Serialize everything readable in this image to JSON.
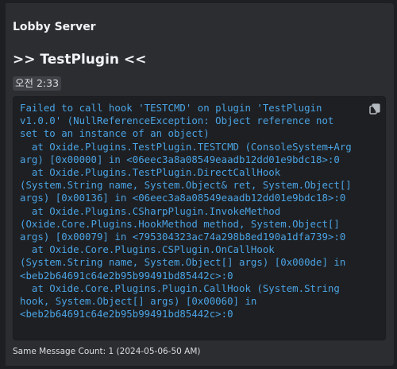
{
  "message": {
    "author": "Lobby Server",
    "title": ">> TestPlugin <<",
    "timestamp": "오전 2:33",
    "code_lines": [
      "Failed to call hook 'TESTCMD' on plugin 'TestPlugin",
      "v1.0.0' (NullReferenceException: Object reference not",
      "set to an instance of an object)",
      "  at Oxide.Plugins.TestPlugin.TESTCMD (ConsoleSystem+Arg",
      "arg) [0x00000] in <06eec3a8a08549eaadb12dd01e9bdc18>:0",
      "  at Oxide.Plugins.TestPlugin.DirectCallHook",
      "(System.String name, System.Object& ret, System.Object[]",
      "args) [0x00136] in <06eec3a8a08549eaadb12dd01e9bdc18>:0",
      "  at Oxide.Plugins.CSharpPlugin.InvokeMethod",
      "(Oxide.Core.Plugins.HookMethod method, System.Object[]",
      "args) [0x00079] in <795304323ac74a298b8ed190a1dfa739>:0",
      "  at Oxide.Core.Plugins.CSPlugin.OnCallHook",
      "(System.String name, System.Object[] args) [0x000de] in",
      "<beb2b64691c64e2b95b99491bd85442c>:0",
      "  at Oxide.Core.Plugins.Plugin.CallHook (System.String",
      "hook, System.Object[] args) [0x00060] in",
      "<beb2b64691c64e2b95b99491bd85442c>:0"
    ],
    "copy_icon": "copy-icon",
    "footer": "Same Message Count: 1 (2024-05-06-50 AM)"
  },
  "colors": {
    "background": "#1e1f22",
    "card": "#2b2d31",
    "code_text": "#4aa3e3",
    "text": "#f2f3f5"
  }
}
